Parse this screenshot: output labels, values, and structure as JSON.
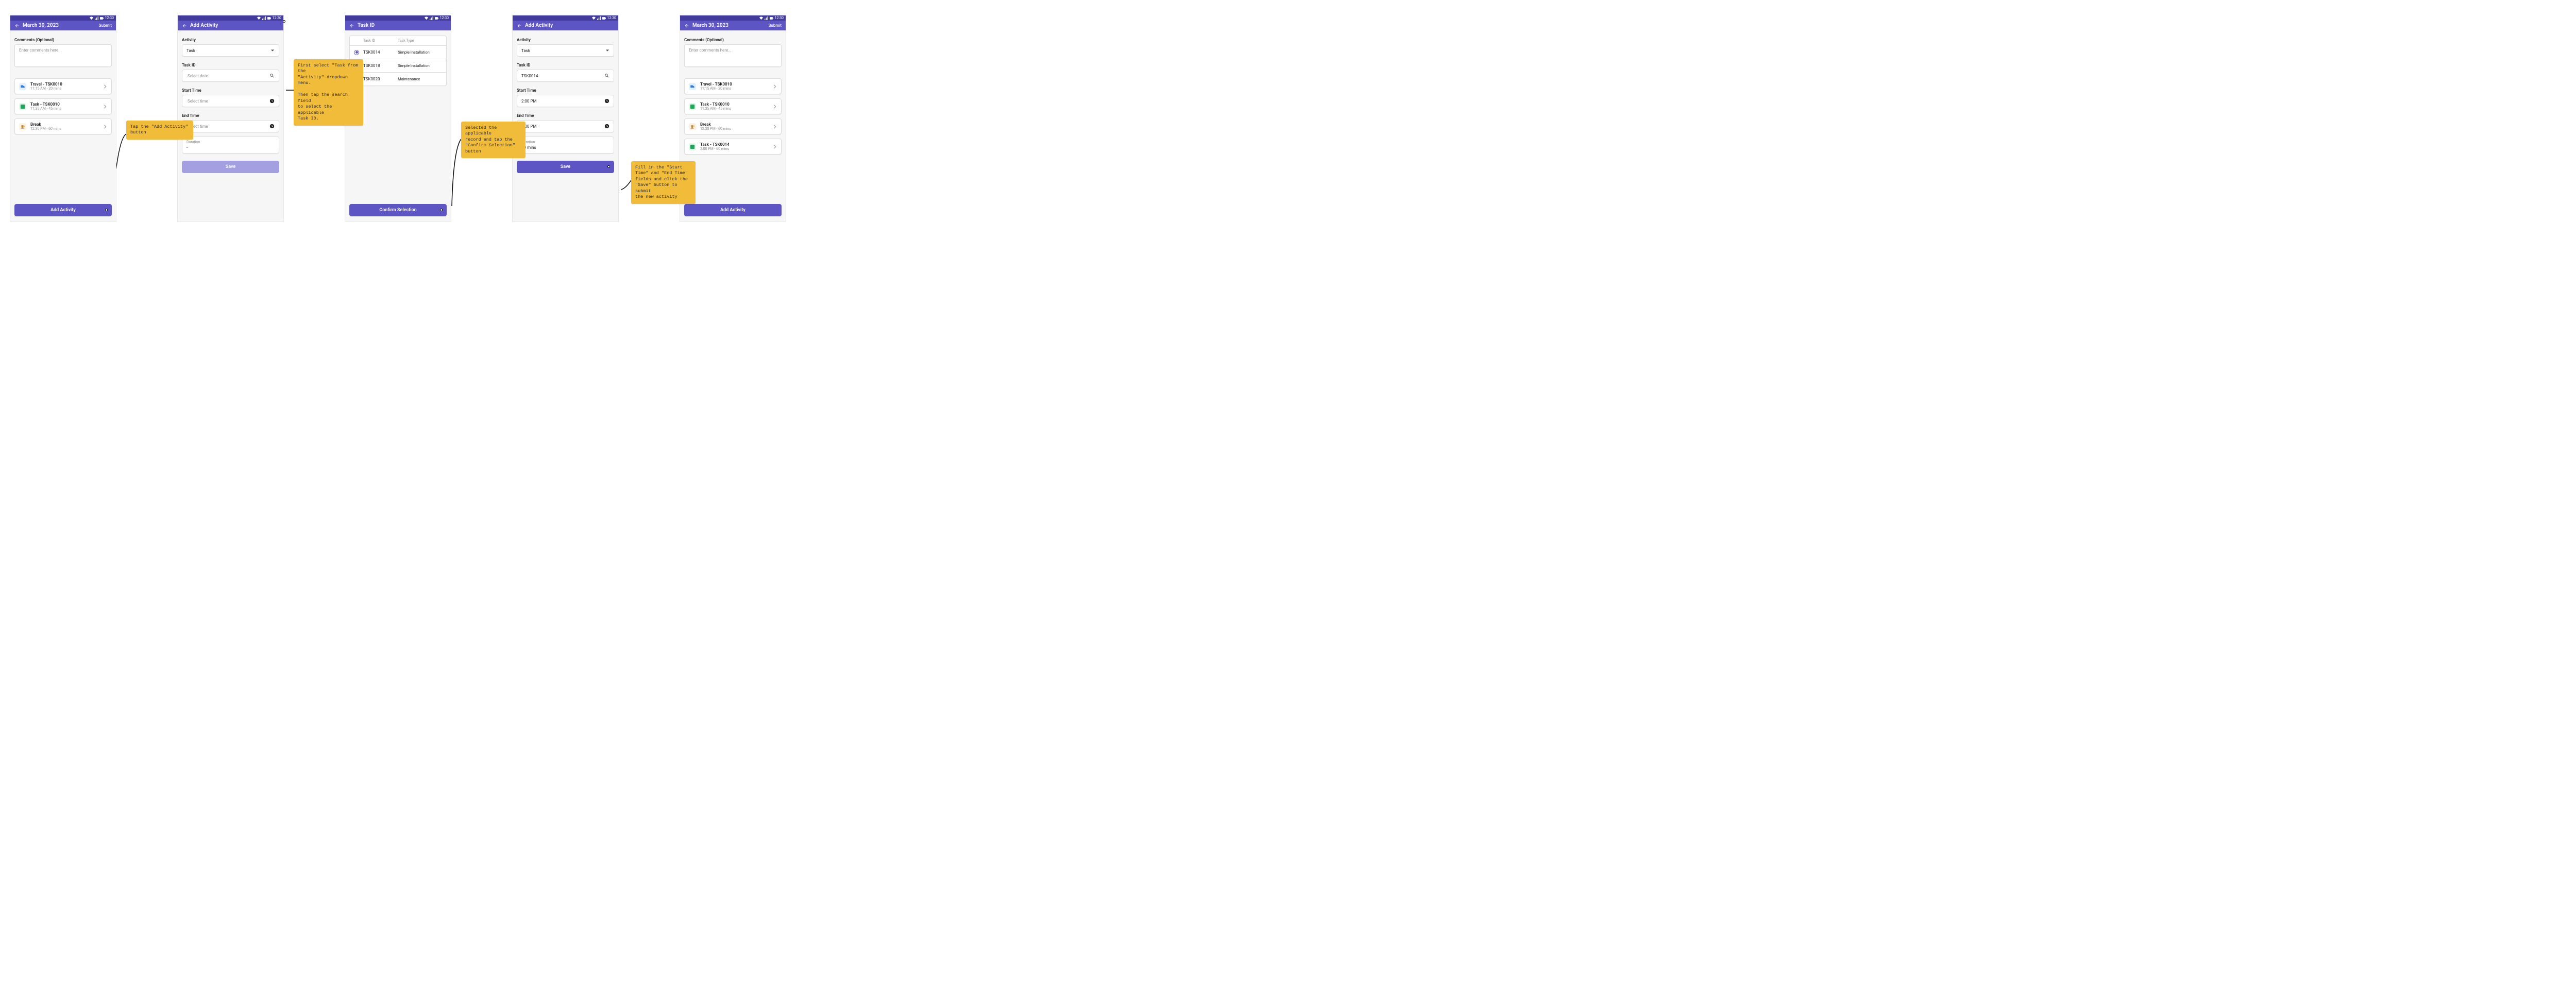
{
  "status": {
    "time": "12:30"
  },
  "screen1": {
    "title": "March 30, 2023",
    "action": "Submit",
    "comments_label": "Comments (Optional)",
    "comments_placeholder": "Enter comments here...",
    "items": [
      {
        "icon": "travel",
        "title": "Travel - TSK0010",
        "sub": "11:15 AM - 20 mins"
      },
      {
        "icon": "task",
        "title": "Task - TSK0010",
        "sub": "11:35 AM - 45 mins"
      },
      {
        "icon": "break",
        "title": "Break",
        "sub": "12:30 PM - 60 mins"
      }
    ],
    "cta": "Add Activity"
  },
  "screen2": {
    "title": "Add Activity",
    "activity_label": "Activity",
    "activity_value": "Task",
    "taskid_label": "Task ID",
    "taskid_placeholder": "Select date",
    "start_label": "Start Time",
    "start_placeholder": "Select time",
    "end_label": "End Time",
    "end_placeholder": "Select time",
    "duration_label": "Duration",
    "duration_value": "-",
    "save": "Save"
  },
  "screen3": {
    "title": "Task ID",
    "col_id": "Task ID",
    "col_type": "Task Type",
    "rows": [
      {
        "id": "TSK0014",
        "type": "Simple Installation",
        "selected": true
      },
      {
        "id": "TSK0018",
        "type": "Simple Installation",
        "selected": false
      },
      {
        "id": "TSK0020",
        "type": "Maintenance",
        "selected": false
      }
    ],
    "cta": "Confirm Selection"
  },
  "screen4": {
    "title": "Add Activity",
    "activity_label": "Activity",
    "activity_value": "Task",
    "taskid_label": "Task ID",
    "taskid_value": "TSK0014",
    "start_label": "Start Time",
    "start_value": "2:00 PM",
    "end_label": "End Time",
    "end_value": "3:00 PM",
    "duration_label": "Duration",
    "duration_value": "60 mins",
    "save": "Save"
  },
  "screen5": {
    "title": "March 30, 2023",
    "action": "Submit",
    "comments_label": "Comments (Optional)",
    "comments_placeholder": "Enter comments here...",
    "items": [
      {
        "icon": "travel",
        "title": "Travel - TSK0010",
        "sub": "11:15 AM - 20 mins"
      },
      {
        "icon": "task",
        "title": "Task - TSK0010",
        "sub": "11:35 AM - 45 mins"
      },
      {
        "icon": "break",
        "title": "Break",
        "sub": "12:30 PM - 60 mins"
      },
      {
        "icon": "task",
        "title": "Task - TSK0014",
        "sub": "2:00 PM - 60 mins"
      }
    ],
    "cta": "Add Activity"
  },
  "notes": {
    "n1": "Tap the \"Add Activity\"\nbutton",
    "n2": "First select \"Task from the\n\"Activity\" dropdown menu.\n\nThen tap the search field\nto select the applicable\nTask ID.",
    "n3": "Selected the applicable\nrecord and tap the\n\"Confirm Selection\"\nbutton",
    "n4": "Fill in the \"Start\nTime\" and \"End Time\"\nfields and click the\n\"Save\" button to submit\nthe new activity"
  }
}
